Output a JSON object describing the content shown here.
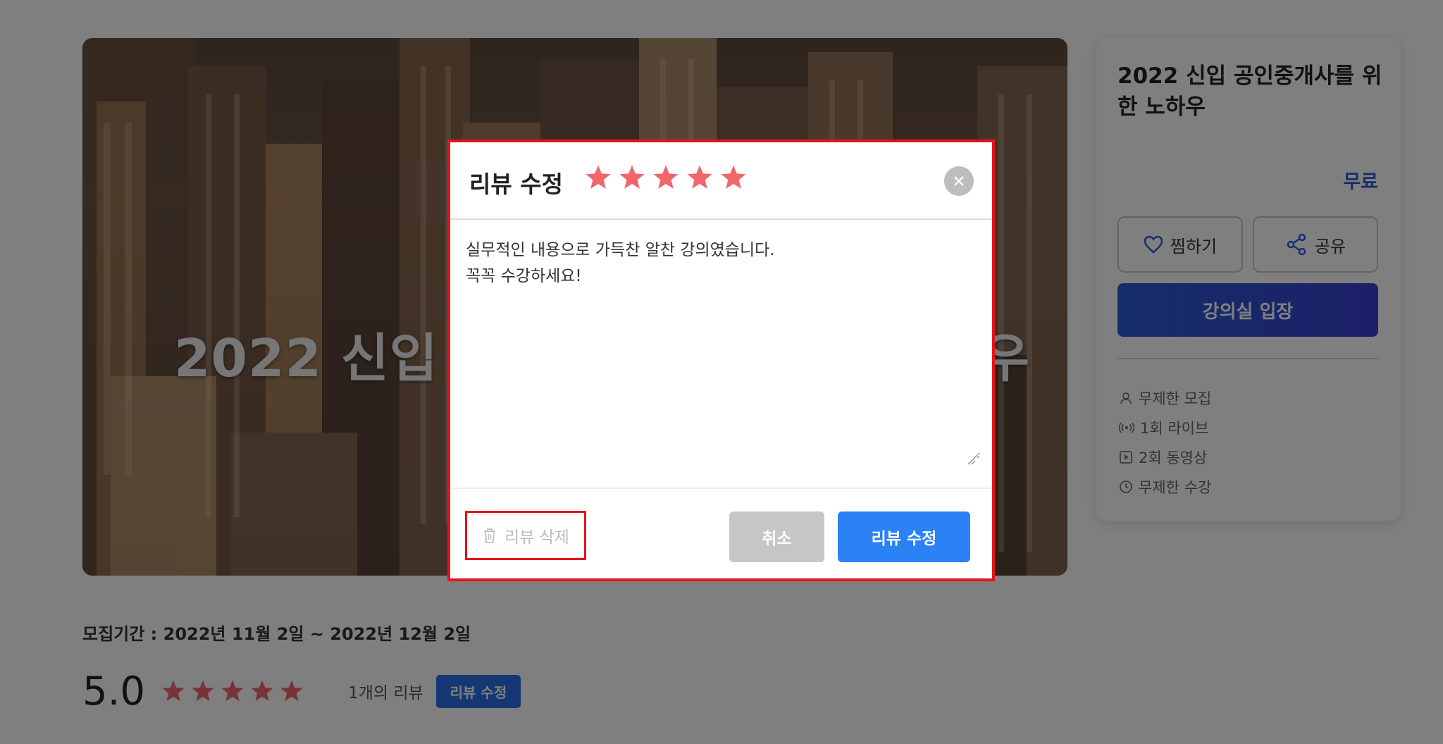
{
  "course": {
    "hero_title": "2022 신입 공인중개사를 위한 노하우",
    "title": "2022 신입 공인중개사를 위한 노하우",
    "price": "무료",
    "like_label": "찜하기",
    "share_label": "공유",
    "enter_label": "강의실 입장",
    "info": [
      {
        "icon": "person-icon",
        "label": "무제한 모집"
      },
      {
        "icon": "live-broadcast-icon",
        "label": "1회 라이브"
      },
      {
        "icon": "video-play-icon",
        "label": "2회 동영상"
      },
      {
        "icon": "clock-icon",
        "label": "무제한 수강"
      }
    ],
    "recruit_period": "모집기간 : 2022년 11월 2일 ~ 2022년 12월 2일",
    "score": "5.0",
    "stars": 5,
    "review_count": "1개의 리뷰",
    "edit_review_badge": "리뷰 수정"
  },
  "modal": {
    "title": "리뷰 수정",
    "rating": 5,
    "review_text": "실무적인 내용으로 가득찬 알찬 강의였습니다.\n꼭꼭 수강하세요!",
    "delete_label": "리뷰 삭제",
    "cancel_label": "취소",
    "submit_label": "리뷰 수정"
  },
  "colors": {
    "star": "#f0676b",
    "accent_blue": "#2a82f5",
    "highlight_red": "#e3141a",
    "price_blue": "#2c5fd6"
  }
}
